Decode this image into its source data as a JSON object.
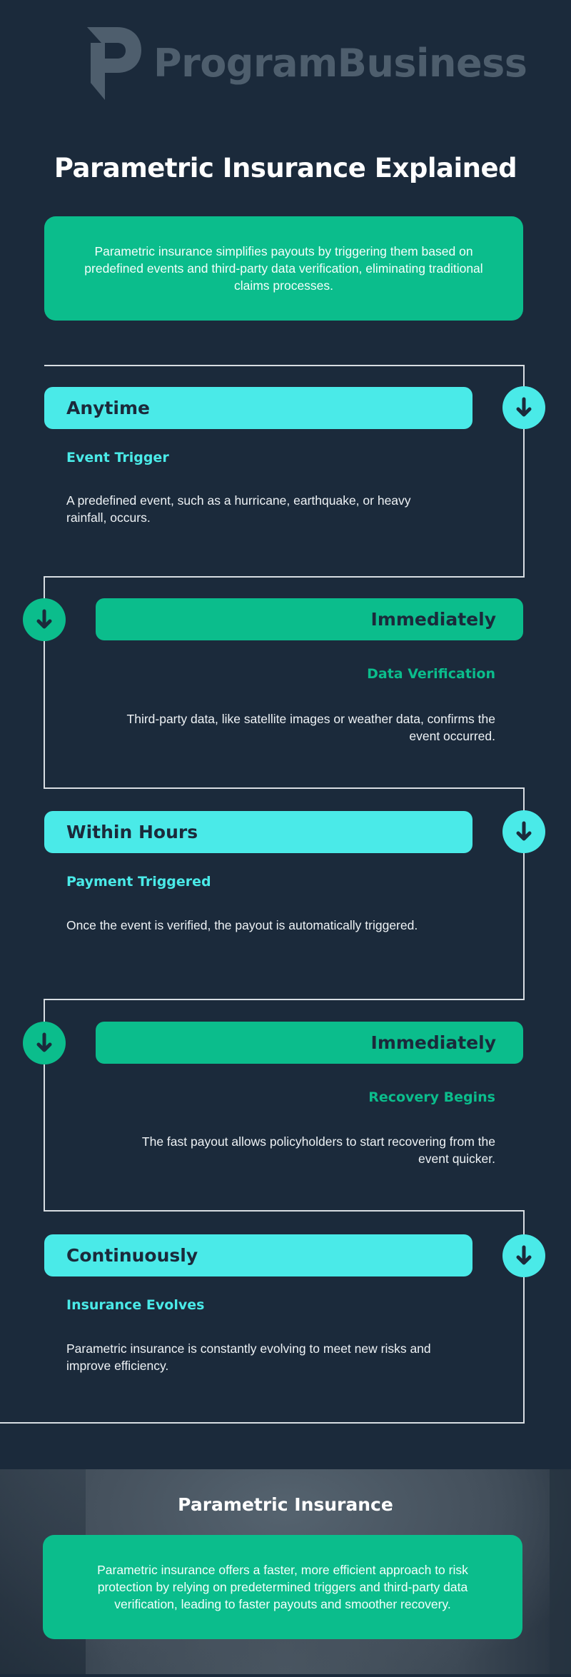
{
  "brand": {
    "logo_icon": "program-business-p-logo-icon",
    "name": "ProgramBusiness"
  },
  "page": {
    "title": "Parametric Insurance Explained",
    "intro": "Parametric insurance simplifies payouts by triggering them based on predefined events and third-party data verification, eliminating traditional claims processes."
  },
  "colors": {
    "background": "#1b2a3b",
    "cyan": "#4aeae8",
    "green": "#0bbd8c",
    "connector_line": "#d8dde2"
  },
  "steps": [
    {
      "timing": "Anytime",
      "title": "Event Trigger",
      "description": "A predefined event, such as a hurricane, earthquake, or heavy rainfall, occurs.",
      "icon": "arrow-down-icon"
    },
    {
      "timing": "Immediately",
      "title": "Data Verification",
      "description": "Third-party data, like satellite images or weather data, confirms the event occurred.",
      "icon": "arrow-down-icon"
    },
    {
      "timing": "Within Hours",
      "title": "Payment Triggered",
      "description": "Once the event is verified, the payout is automatically triggered.",
      "icon": "arrow-down-icon"
    },
    {
      "timing": "Immediately",
      "title": "Recovery Begins",
      "description": "The fast payout allows policyholders to start recovering from the event quicker.",
      "icon": "arrow-down-icon"
    },
    {
      "timing": "Continuously",
      "title": "Insurance Evolves",
      "description": "Parametric insurance is constantly evolving to meet new risks and improve efficiency.",
      "icon": "arrow-down-icon"
    }
  ],
  "footer": {
    "title": "Parametric Insurance",
    "text": "Parametric insurance offers a faster, more efficient approach to risk protection by relying on predetermined triggers and third-party data verification, leading to faster payouts and smoother recovery."
  }
}
